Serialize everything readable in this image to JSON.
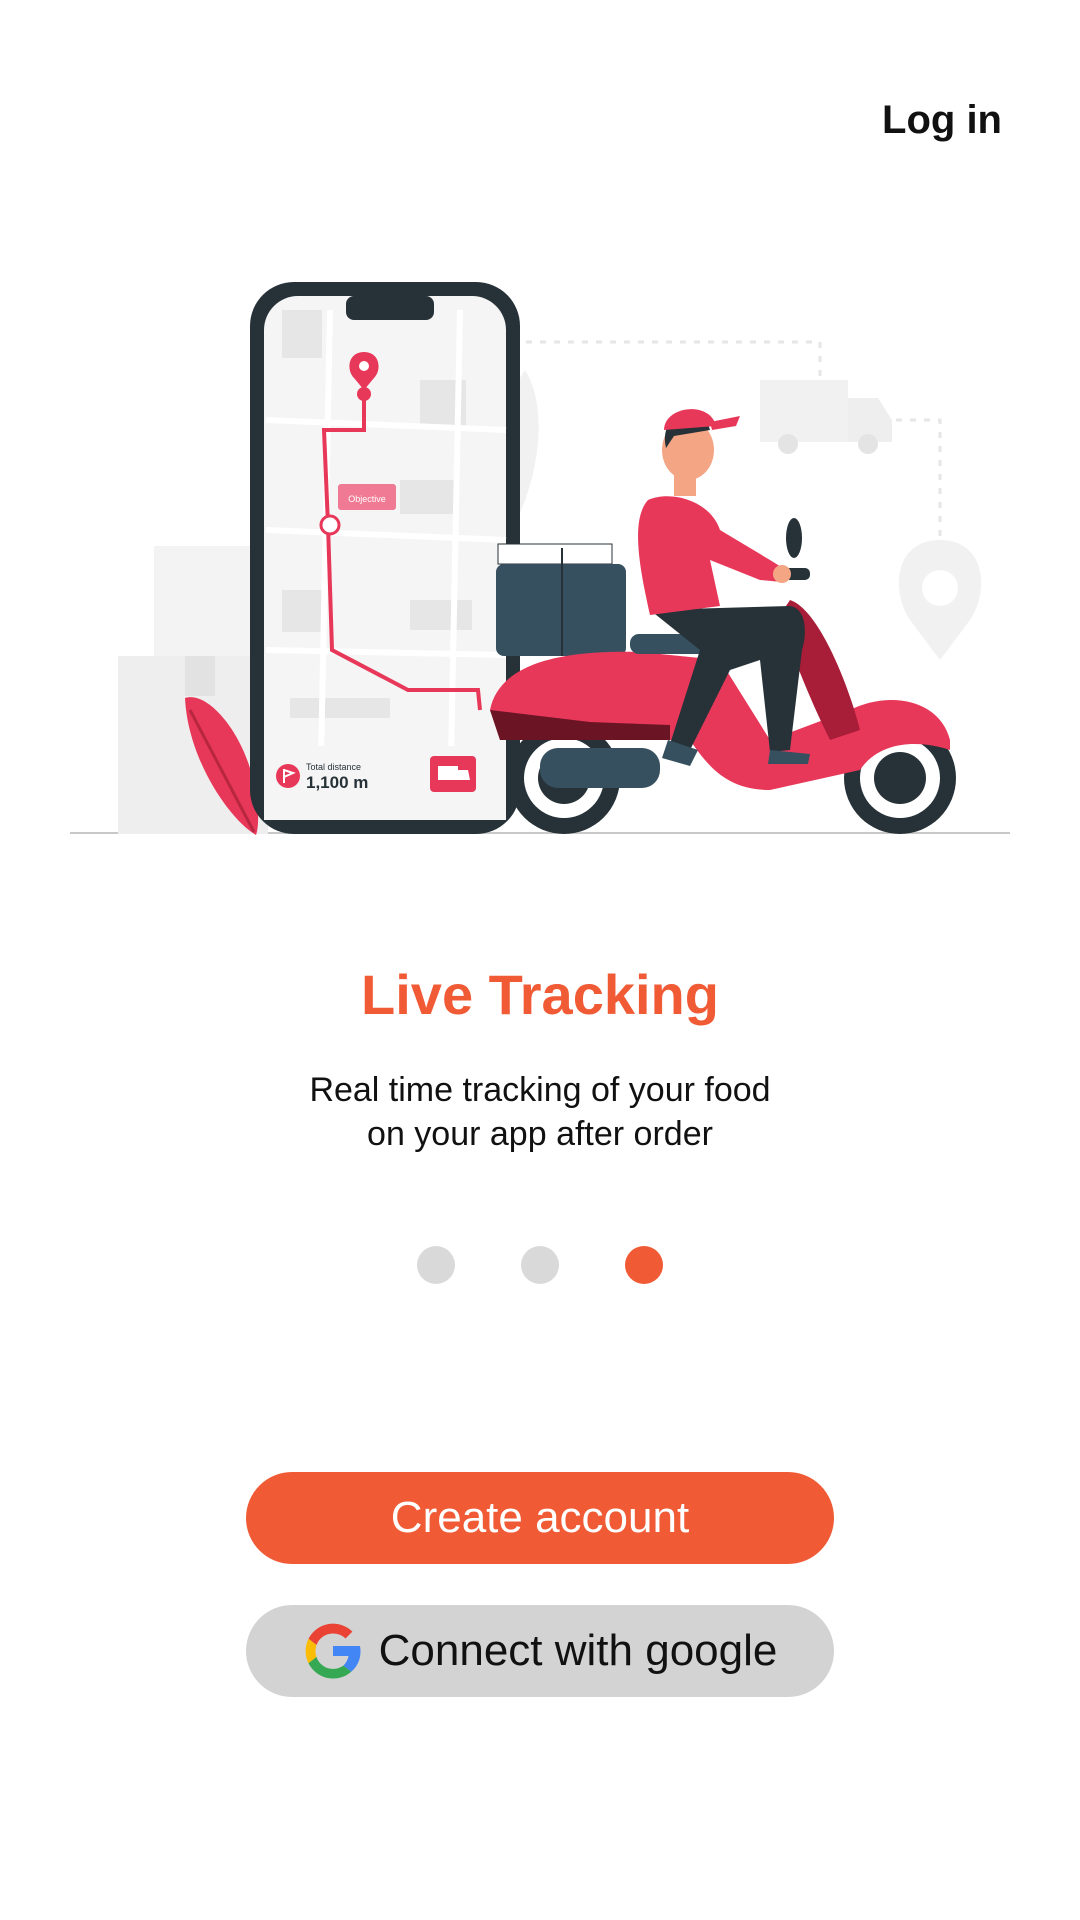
{
  "header": {
    "login_label": "Log in"
  },
  "illustration": {
    "objective_label": "Objective",
    "distance_label": "Total distance",
    "distance_value": "1,100 m"
  },
  "onboarding": {
    "title": "Live Tracking",
    "subtitle_lines": [
      "Real time tracking of your food",
      "on your app after order"
    ],
    "pages_total": 3,
    "active_page": 3
  },
  "actions": {
    "create_account_label": "Create account",
    "google_label": "Connect with google"
  },
  "colors": {
    "accent": "#f05a35",
    "dot_inactive": "#d9d9d9",
    "google_button_bg": "#d3d3d3",
    "illustration_red": "#e8385a",
    "illustration_dark": "#263238"
  },
  "icons": [
    "google-icon",
    "map-pin-icon",
    "delivery-truck-icon",
    "flag-icon"
  ]
}
